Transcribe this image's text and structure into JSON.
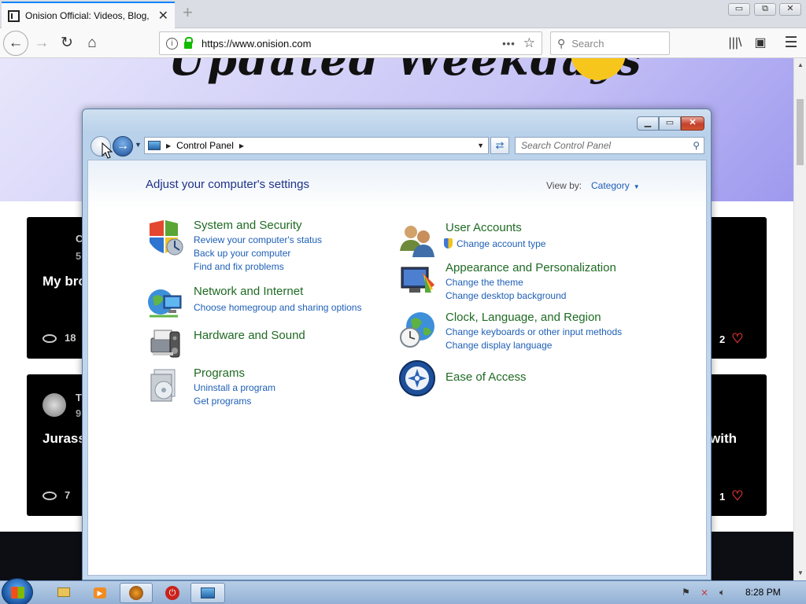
{
  "browser": {
    "tab_title": "Onision Official: Videos, Blog, F",
    "url": "https://www.onision.com",
    "search_placeholder": "Search",
    "new_tab_label": "+",
    "window_buttons": {
      "minimize": "▭",
      "restore": "⧉",
      "close": "✕"
    }
  },
  "webpage": {
    "hero_text": "Updated Weekdays",
    "cards": [
      {
        "title_fragment": "My bro",
        "channel_fragment": "C",
        "meta_fragment": "5",
        "views": "18",
        "likes": "2"
      },
      {
        "title_fragment": "Jurass",
        "channel_fragment": "T",
        "meta_fragment": "9",
        "views": "7",
        "likes": "1",
        "right_fragment": "with"
      }
    ]
  },
  "control_panel": {
    "breadcrumb": "Control Panel",
    "search_placeholder": "Search Control Panel",
    "heading": "Adjust your computer's settings",
    "view_by_label": "View by:",
    "view_by_value": "Category",
    "categories_left": [
      {
        "title": "System and Security",
        "icon": "system-security-icon",
        "links": [
          "Review your computer's status",
          "Back up your computer",
          "Find and fix problems"
        ]
      },
      {
        "title": "Network and Internet",
        "icon": "network-internet-icon",
        "links": [
          "Choose homegroup and sharing options"
        ]
      },
      {
        "title": "Hardware and Sound",
        "icon": "hardware-sound-icon",
        "links": []
      },
      {
        "title": "Programs",
        "icon": "programs-icon",
        "links": [
          "Uninstall a program",
          "Get programs"
        ]
      }
    ],
    "categories_right": [
      {
        "title": "User Accounts",
        "icon": "user-accounts-icon",
        "links": [
          "Change account type"
        ]
      },
      {
        "title": "Appearance and Personalization",
        "icon": "appearance-icon",
        "links": [
          "Change the theme",
          "Change desktop background"
        ]
      },
      {
        "title": "Clock, Language, and Region",
        "icon": "clock-region-icon",
        "links": [
          "Change keyboards or other input methods",
          "Change display language"
        ]
      },
      {
        "title": "Ease of Access",
        "icon": "ease-of-access-icon",
        "links": []
      }
    ]
  },
  "taskbar": {
    "clock": "8:28 PM"
  },
  "colors": {
    "category_title": "#1f6a23",
    "link": "#1e5fb6",
    "heading": "#1e3287",
    "firefox_accent": "#0a84ff"
  }
}
